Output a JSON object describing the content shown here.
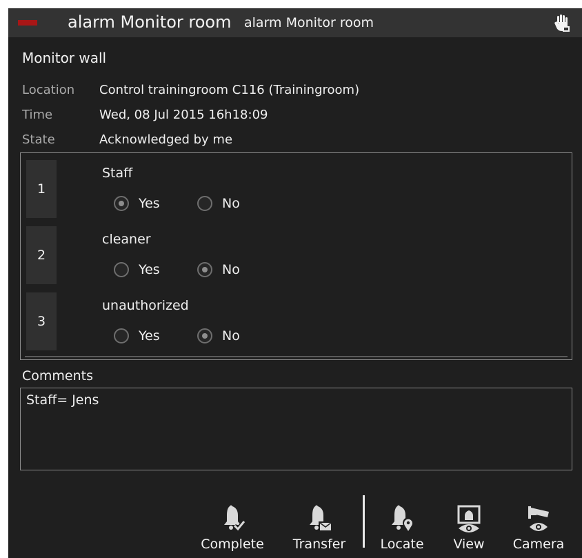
{
  "title": {
    "main": "alarm Monitor room",
    "sub": "alarm Monitor room"
  },
  "section_title": "Monitor wall",
  "details": [
    {
      "label": "Location",
      "value": "Control trainingroom C116 (Trainingroom)"
    },
    {
      "label": "Time",
      "value": "Wed, 08 Jul 2015  16h18:09"
    },
    {
      "label": "State",
      "value": "Acknowledged by me"
    }
  ],
  "questions": [
    {
      "number": "1",
      "label": "Staff",
      "yes": "Yes",
      "no": "No",
      "selected": "yes"
    },
    {
      "number": "2",
      "label": "cleaner",
      "yes": "Yes",
      "no": "No",
      "selected": "no"
    },
    {
      "number": "3",
      "label": "unauthorized",
      "yes": "Yes",
      "no": "No",
      "selected": "no"
    }
  ],
  "comments": {
    "label": "Comments",
    "value": "Staff= Jens"
  },
  "toolbar": {
    "complete": "Complete",
    "transfer": "Transfer",
    "locate": "Locate",
    "view": "View",
    "camera": "Camera"
  },
  "colors": {
    "background": "#1f1f1f",
    "titlebar": "#333333",
    "marker": "#a81616"
  },
  "icons": [
    "hand-stop-icon",
    "bell-check-icon",
    "bell-mail-icon",
    "bell-location-icon",
    "monitor-eye-icon",
    "security-camera-icon"
  ]
}
